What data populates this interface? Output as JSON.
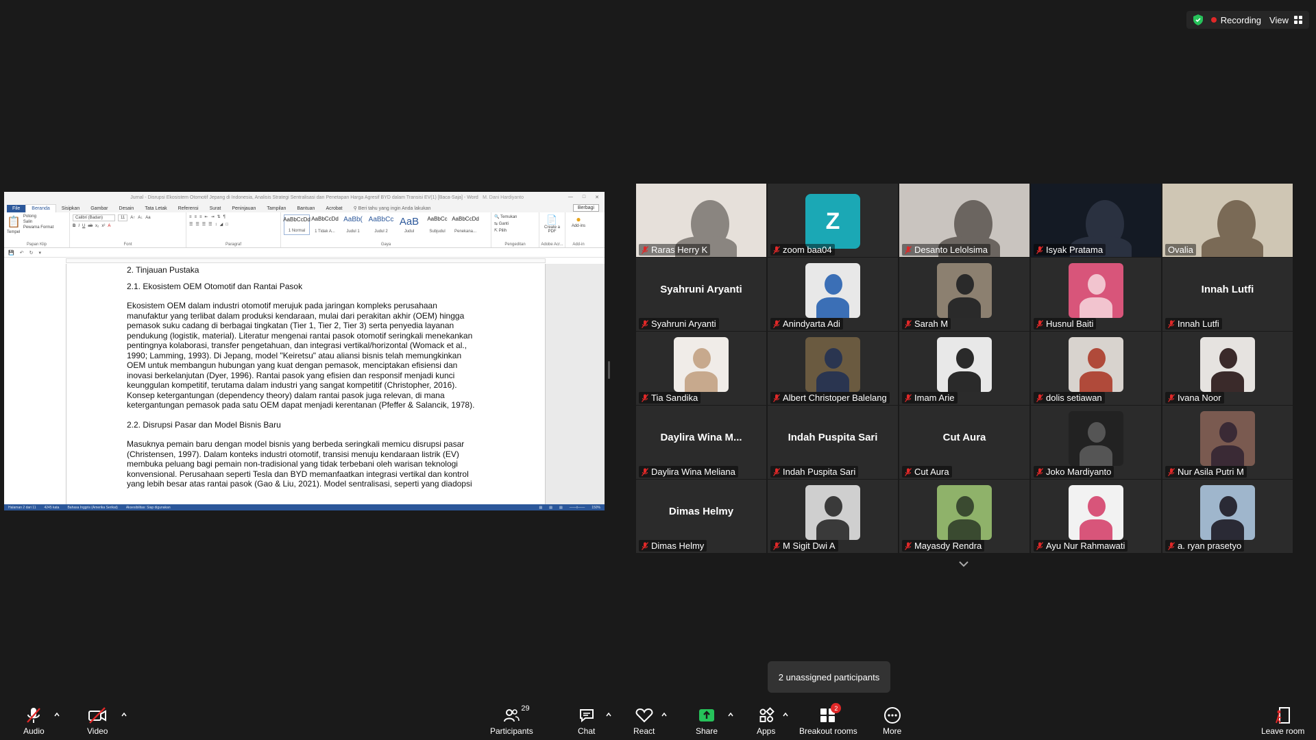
{
  "top_bar": {
    "recording_label": "Recording",
    "view_label": "View"
  },
  "shared_document": {
    "title_bar": "Jurnal - Disrupsi Ekosistem Otomotif Jepang di Indonesia, Analisis Strategi Sentralisasi dan Penetapan Harga Agresif BYD dalam Transisi EV(1) [Baca-Saja] - Word",
    "account": "M. Dani Hardiyanto",
    "tabs": [
      "File",
      "Beranda",
      "Sisipkan",
      "Gambar",
      "Desain",
      "Tata Letak",
      "Referensi",
      "Surat",
      "Peninjauan",
      "Tampilan",
      "Bantuan",
      "Acrobat"
    ],
    "active_tab": "Beranda",
    "tell_me": "Beri tahu yang ingin Anda lakukan",
    "share_label": "Berbagi",
    "clipboard": {
      "paste": "Tempel",
      "cut": "Potong",
      "copy": "Salin",
      "format_painter": "Pewarna Format",
      "group": "Papan Klip"
    },
    "font": {
      "name": "Calibri (Badan)",
      "size": "11",
      "group": "Font"
    },
    "paragraph_group": "Paragraf",
    "styles": [
      {
        "preview": "AaBbCcDd",
        "name": "1 Normal"
      },
      {
        "preview": "AaBbCcDd",
        "name": "1 Tidak A..."
      },
      {
        "preview": "AaBb(",
        "name": "Judul 1"
      },
      {
        "preview": "AaBbCc",
        "name": "Judul 2"
      },
      {
        "preview": "AaB",
        "name": "Judul"
      },
      {
        "preview": "AaBbCc",
        "name": "Subjudul"
      },
      {
        "preview": "AaBbCcDd",
        "name": "Penekana..."
      }
    ],
    "styles_group": "Gaya",
    "editing": {
      "find": "Temukan",
      "replace": "Ganti",
      "select": "Pilih",
      "group": "Pengeditan"
    },
    "adobe": {
      "label": "Create a PDF",
      "group": "Adobe Acr..."
    },
    "addins": {
      "label": "Add-ins",
      "group": "Add-in"
    },
    "body": {
      "h1": "2. Tinjauan Pustaka",
      "h2a": "2.1. Ekosistem OEM Otomotif dan Rantai Pasok",
      "lines_a": [
        "Ekosistem OEM dalam industri otomotif merujuk pada jaringan kompleks perusahaan",
        "manufaktur yang terlibat dalam produksi kendaraan, mulai dari perakitan akhir (OEM) hingga",
        "pemasok suku cadang di berbagai tingkatan (Tier 1, Tier 2, Tier 3) serta penyedia layanan",
        "pendukung (logistik, material). Literatur mengenai rantai pasok otomotif seringkali menekankan",
        "pentingnya kolaborasi, transfer pengetahuan, dan integrasi vertikal/horizontal (Womack et al.,",
        "1990; Lamming, 1993). Di Jepang, model \"Keiretsu\" atau aliansi bisnis telah memungkinkan",
        "OEM untuk membangun hubungan yang kuat dengan pemasok, menciptakan efisiensi dan",
        "inovasi berkelanjutan (Dyer, 1996). Rantai pasok yang efisien dan responsif menjadi kunci",
        "keunggulan kompetitif, terutama dalam industri yang sangat kompetitif (Christopher, 2016).",
        "Konsep ketergantungan (dependency theory) dalam rantai pasok juga relevan, di mana",
        "ketergantungan pemasok pada satu OEM dapat menjadi kerentanan (Pfeffer & Salancik, 1978)."
      ],
      "h2b": "2.2. Disrupsi Pasar dan Model Bisnis Baru",
      "lines_b": [
        "Masuknya pemain baru dengan model bisnis yang berbeda seringkali memicu disrupsi pasar",
        "(Christensen, 1997). Dalam konteks industri otomotif, transisi menuju kendaraan listrik (EV)",
        "membuka peluang bagi pemain non-tradisional yang tidak terbebani oleh warisan teknologi",
        "konvensional. Perusahaan seperti Tesla dan BYD memanfaatkan integrasi vertikal dan kontrol",
        "yang lebih besar atas rantai pasok (Gao & Liu, 2021). Model sentralisasi, seperti yang diadopsi"
      ]
    },
    "status": {
      "page": "Halaman 2 dari 11",
      "words": "4245 kata",
      "language": "Bahasa Inggris (Amerika Serikat)",
      "accessibility": "Aksesibilitas: Siap digunakan",
      "zoom": "150%"
    }
  },
  "participants": [
    {
      "name": "Raras Herry K",
      "kind": "video"
    },
    {
      "name": "zoom baa04",
      "kind": "letter",
      "letter": "Z"
    },
    {
      "name": "Desanto Lelolsima",
      "kind": "video"
    },
    {
      "name": "Isyak Pratama",
      "kind": "video"
    },
    {
      "name": "Ovalia",
      "kind": "video",
      "active": true
    },
    {
      "name": "Syahruni Aryanti",
      "kind": "text",
      "display": "Syahruni Aryanti"
    },
    {
      "name": "Anindyarta Adi",
      "kind": "photo"
    },
    {
      "name": "Sarah M",
      "kind": "photo"
    },
    {
      "name": "Husnul Baiti",
      "kind": "photo"
    },
    {
      "name": "Innah Lutfi",
      "kind": "text",
      "display": "Innah Lutfi"
    },
    {
      "name": "Tia Sandika",
      "kind": "photo"
    },
    {
      "name": "Albert Christoper Balelang",
      "kind": "photo"
    },
    {
      "name": "Imam Arie",
      "kind": "photo"
    },
    {
      "name": "dolis setiawan",
      "kind": "photo"
    },
    {
      "name": "Ivana Noor",
      "kind": "photo"
    },
    {
      "name": "Daylira Wina Meliana",
      "kind": "text",
      "display": "Daylira Wina M..."
    },
    {
      "name": "Indah Puspita Sari",
      "kind": "text",
      "display": "Indah Puspita Sari"
    },
    {
      "name": "Cut Aura",
      "kind": "text",
      "display": "Cut Aura"
    },
    {
      "name": "Joko Mardiyanto",
      "kind": "photo"
    },
    {
      "name": "Nur Asila Putri M",
      "kind": "photo"
    },
    {
      "name": "Dimas Helmy",
      "kind": "text",
      "display": "Dimas Helmy"
    },
    {
      "name": "M Sigit Dwi A",
      "kind": "photo"
    },
    {
      "name": "Mayasdy Rendra",
      "kind": "photo"
    },
    {
      "name": "Ayu Nur Rahmawati",
      "kind": "photo"
    },
    {
      "name": "a. ryan prasetyo",
      "kind": "photo"
    }
  ],
  "tooltip": "2 unassigned participants",
  "toolbar": {
    "audio": "Audio",
    "video": "Video",
    "participants": "Participants",
    "participant_count": "29",
    "chat": "Chat",
    "react": "React",
    "share": "Share",
    "apps": "Apps",
    "breakout": "Breakout rooms",
    "breakout_badge": "2",
    "more": "More",
    "leave": "Leave room"
  },
  "colors": {
    "accent_green": "#26c25a",
    "mute_red": "#e02828",
    "word_blue": "#2b579a",
    "letter_tile": "#1ba8b5"
  }
}
